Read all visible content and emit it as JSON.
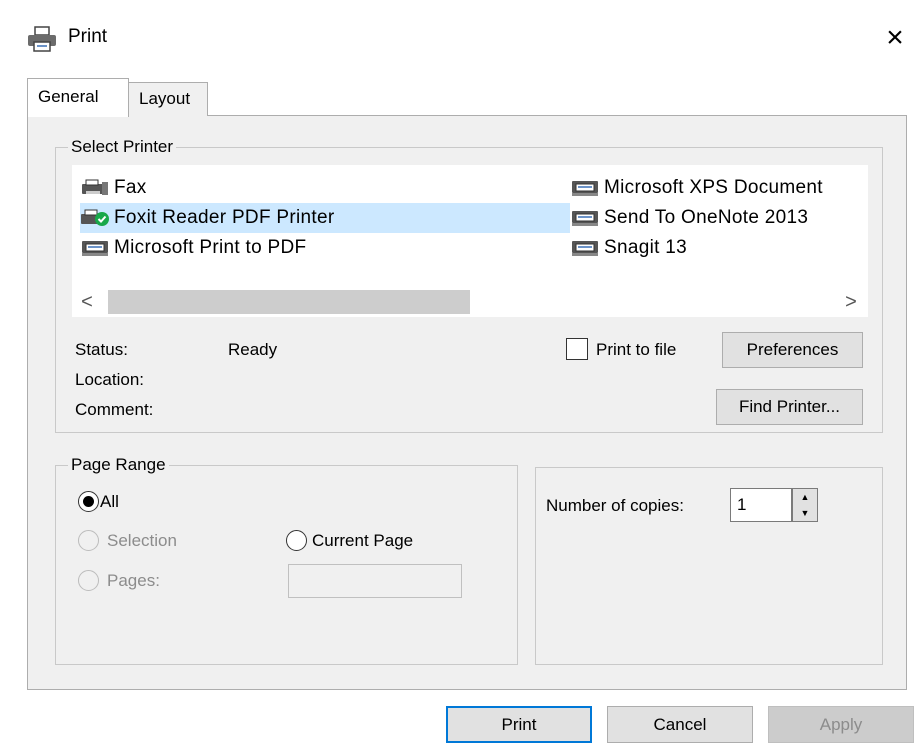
{
  "window": {
    "title": "Print",
    "close_glyph": "×"
  },
  "tabs": [
    {
      "label": "General",
      "active": true
    },
    {
      "label": "Layout",
      "active": false
    }
  ],
  "select_printer": {
    "legend": "Select Printer",
    "printers": [
      {
        "name": "Fax",
        "icon": "fax-icon",
        "selected": false
      },
      {
        "name": "Foxit Reader PDF Printer",
        "icon": "default-printer-icon",
        "selected": true
      },
      {
        "name": "Microsoft Print to PDF",
        "icon": "printer-icon",
        "selected": false
      },
      {
        "name": "Microsoft XPS Document",
        "icon": "printer-icon",
        "selected": false
      },
      {
        "name": "Send To OneNote 2013",
        "icon": "printer-icon",
        "selected": false
      },
      {
        "name": "Snagit 13",
        "icon": "printer-icon",
        "selected": false
      }
    ],
    "scroll_left": "<",
    "scroll_right": ">",
    "status_label": "Status:",
    "status_value": "Ready",
    "location_label": "Location:",
    "comment_label": "Comment:",
    "print_to_file_label": "Print to file",
    "print_to_file_checked": false,
    "preferences_label": "Preferences",
    "find_printer_label": "Find Printer..."
  },
  "page_range": {
    "legend": "Page Range",
    "all_label": "All",
    "selection_label": "Selection",
    "current_page_label": "Current Page",
    "pages_label": "Pages:",
    "selected_option": "All",
    "pages_value": ""
  },
  "copies": {
    "label": "Number of copies:",
    "value": "1"
  },
  "footer": {
    "print_label": "Print",
    "cancel_label": "Cancel",
    "apply_label": "Apply"
  },
  "colors": {
    "accent": "#0078d7",
    "selection": "#cce8ff",
    "panel": "#f0f0f0",
    "default_check": "#18a84a"
  }
}
